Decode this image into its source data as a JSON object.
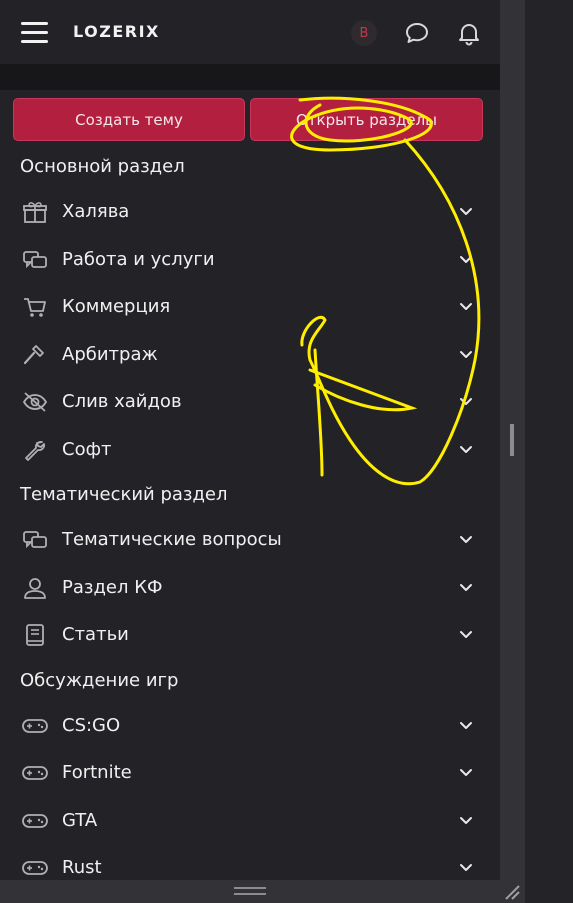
{
  "header": {
    "logo": "LOZERIX",
    "avatar_letter": "B",
    "icons": [
      "menu-icon",
      "chat-icon",
      "bell-icon"
    ]
  },
  "actions": {
    "create_label": "Создать тему",
    "open_label": "Открыть разделы"
  },
  "sections": [
    {
      "title": "Основной раздел",
      "items": [
        {
          "label": "Халява",
          "icon": "gift-icon"
        },
        {
          "label": "Работа и услуги",
          "icon": "chat-bubbles-icon"
        },
        {
          "label": "Коммерция",
          "icon": "cart-icon"
        },
        {
          "label": "Арбитраж",
          "icon": "hammer-icon"
        },
        {
          "label": "Слив хайдов",
          "icon": "eye-slash-icon"
        },
        {
          "label": "Софт",
          "icon": "wrench-icon"
        }
      ]
    },
    {
      "title": "Тематический раздел",
      "items": [
        {
          "label": "Тематические вопросы",
          "icon": "chat-bubbles-icon"
        },
        {
          "label": "Раздел КФ",
          "icon": "user-icon"
        },
        {
          "label": "Статьи",
          "icon": "book-icon"
        }
      ]
    },
    {
      "title": "Обсуждение игр",
      "items": [
        {
          "label": "CS:GO",
          "icon": "gamepad-icon"
        },
        {
          "label": "Fortnite",
          "icon": "gamepad-icon"
        },
        {
          "label": "GTA",
          "icon": "gamepad-icon"
        },
        {
          "label": "Rust",
          "icon": "gamepad-icon"
        }
      ]
    }
  ],
  "colors": {
    "background": "#232327",
    "accent": "#b3203f",
    "annotation": "#ffee00"
  }
}
